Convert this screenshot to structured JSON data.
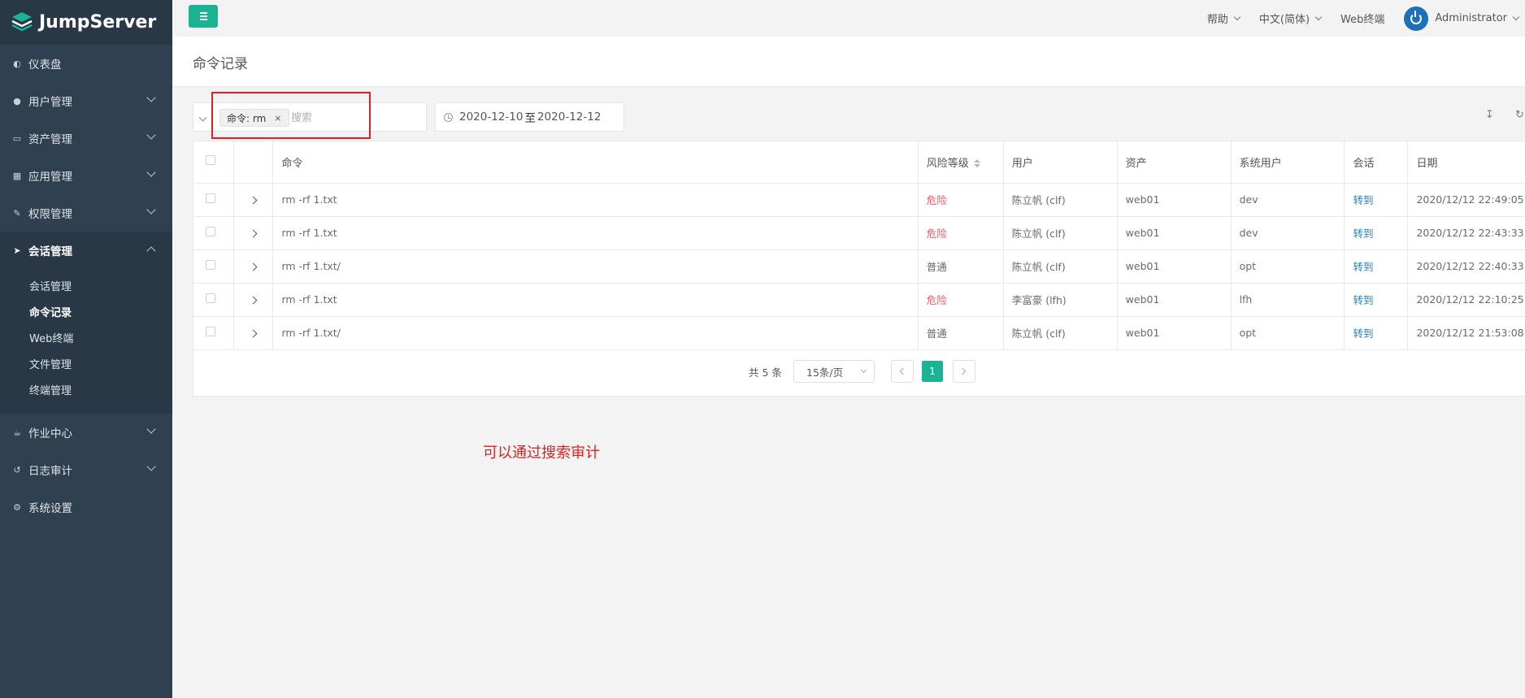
{
  "brand": {
    "name": "JumpServer"
  },
  "sidebar": {
    "items": [
      {
        "label": "仪表盘",
        "icon": "dashboard-icon",
        "has_children": false
      },
      {
        "label": "用户管理",
        "icon": "users-icon",
        "has_children": true
      },
      {
        "label": "资产管理",
        "icon": "inbox-icon",
        "has_children": true
      },
      {
        "label": "应用管理",
        "icon": "grid-icon",
        "has_children": true
      },
      {
        "label": "权限管理",
        "icon": "edit-icon",
        "has_children": true
      },
      {
        "label": "会话管理",
        "icon": "rocket-icon",
        "has_children": true,
        "expanded": true
      }
    ],
    "sub_items": [
      {
        "label": "会话管理"
      },
      {
        "label": "命令记录",
        "current": true
      },
      {
        "label": "Web终端"
      },
      {
        "label": "文件管理"
      },
      {
        "label": "终端管理"
      }
    ],
    "items_after": [
      {
        "label": "作业中心",
        "icon": "coffee-icon",
        "has_children": true
      },
      {
        "label": "日志审计",
        "icon": "history-icon",
        "has_children": true
      },
      {
        "label": "系统设置",
        "icon": "gears-icon",
        "has_children": false
      }
    ]
  },
  "topbar": {
    "help": "帮助",
    "language": "中文(简体)",
    "web_terminal": "Web终端",
    "user": "Administrator"
  },
  "page": {
    "title": "命令记录"
  },
  "filter": {
    "tag_label": "命令: rm",
    "tag_close": "×",
    "search_placeholder": "搜索",
    "date_start": "2020-12-10",
    "date_sep": "至",
    "date_end": "2020-12-12"
  },
  "table": {
    "headers": {
      "command": "命令",
      "risk": "风险等级",
      "user": "用户",
      "asset": "资产",
      "system_user": "系统用户",
      "session": "会话",
      "date": "日期"
    },
    "rows": [
      {
        "command": "rm -rf 1.txt",
        "risk": "危险",
        "risk_level": "danger",
        "user": "陈立帆 (clf)",
        "asset": "web01",
        "system_user": "dev",
        "session": "转到",
        "date": "2020/12/12 22:49:05"
      },
      {
        "command": "rm -rf 1.txt",
        "risk": "危险",
        "risk_level": "danger",
        "user": "陈立帆 (clf)",
        "asset": "web01",
        "system_user": "dev",
        "session": "转到",
        "date": "2020/12/12 22:43:33"
      },
      {
        "command": "rm -rf 1.txt/",
        "risk": "普通",
        "risk_level": "normal",
        "user": "陈立帆 (clf)",
        "asset": "web01",
        "system_user": "opt",
        "session": "转到",
        "date": "2020/12/12 22:40:33"
      },
      {
        "command": "rm -rf 1.txt",
        "risk": "危险",
        "risk_level": "danger",
        "user": "李富豪 (lfh)",
        "asset": "web01",
        "system_user": "lfh",
        "session": "转到",
        "date": "2020/12/12 22:10:25"
      },
      {
        "command": "rm -rf 1.txt/",
        "risk": "普通",
        "risk_level": "normal",
        "user": "陈立帆 (clf)",
        "asset": "web01",
        "system_user": "opt",
        "session": "转到",
        "date": "2020/12/12 21:53:08"
      }
    ]
  },
  "pagination": {
    "total": "共 5 条",
    "page_size": "15条/页",
    "current_page": "1"
  },
  "annotation": {
    "text": "可以通过搜索审计"
  },
  "colors": {
    "accent": "#1ab394",
    "sidebar_bg": "#2f4050",
    "danger": "#ed5565",
    "link": "#1c84c6",
    "annotation": "#e02020"
  }
}
